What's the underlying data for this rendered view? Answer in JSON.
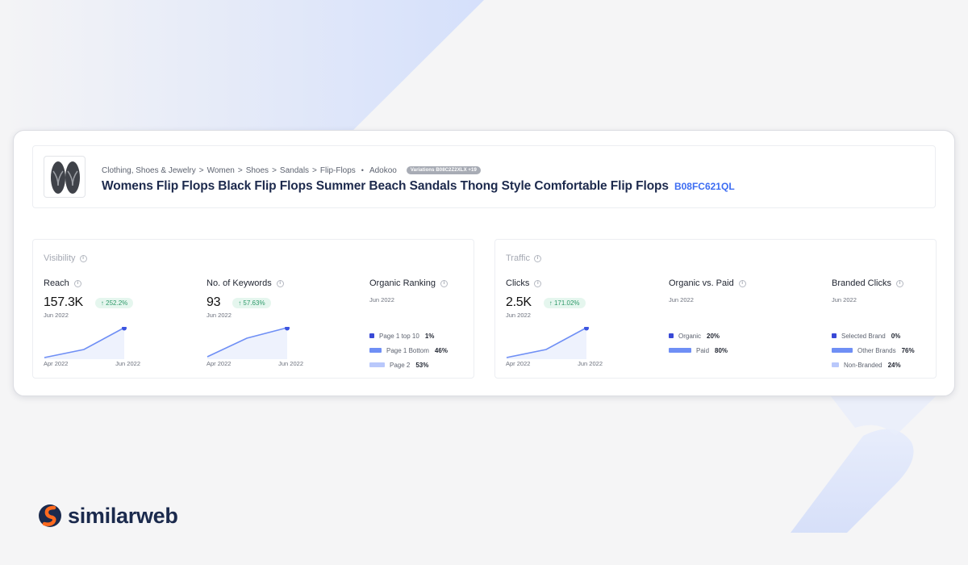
{
  "product": {
    "breadcrumb": [
      "Clothing, Shoes & Jewelry",
      "Women",
      "Shoes",
      "Sandals",
      "Flip-Flops"
    ],
    "brand": "Adokoo",
    "variations": "Variations B08C2Z2XLX +19",
    "title": "Womens Flip Flops Black Flip Flops Summer Beach Sandals Thong Style Comfortable Flip Flops",
    "asin": "B08FC621QL"
  },
  "visibility": {
    "title": "Visibility",
    "reach": {
      "label": "Reach",
      "value": "157.3K",
      "change": "↑ 252.2%",
      "period": "Jun 2022",
      "x_start": "Apr 2022",
      "x_end": "Jun 2022"
    },
    "keywords": {
      "label": "No. of Keywords",
      "value": "93",
      "change": "↑ 57.63%",
      "period": "Jun 2022",
      "x_start": "Apr 2022",
      "x_end": "Jun 2022"
    },
    "organic_ranking": {
      "label": "Organic Ranking",
      "period": "Jun 2022",
      "items": [
        {
          "label": "Page 1 top 10",
          "pct": "1%",
          "value": 1,
          "color": "#3949d6"
        },
        {
          "label": "Page 1 Bottom",
          "pct": "46%",
          "value": 46,
          "color": "#6f8ff5"
        },
        {
          "label": "Page 2",
          "pct": "53%",
          "value": 53,
          "color": "#b9c8fb"
        }
      ]
    }
  },
  "traffic": {
    "title": "Traffic",
    "clicks": {
      "label": "Clicks",
      "value": "2.5K",
      "change": "↑ 171.02%",
      "period": "Jun 2022",
      "x_start": "Apr 2022",
      "x_end": "Jun 2022"
    },
    "organic_vs_paid": {
      "label": "Organic vs. Paid",
      "period": "Jun 2022",
      "items": [
        {
          "label": "Organic",
          "pct": "20%",
          "value": 20,
          "color": "#3949d6"
        },
        {
          "label": "Paid",
          "pct": "80%",
          "value": 80,
          "color": "#6f8ff5"
        }
      ]
    },
    "branded_clicks": {
      "label": "Branded Clicks",
      "period": "Jun 2022",
      "items": [
        {
          "label": "Selected Brand",
          "pct": "0%",
          "value": 0,
          "color": "#3949d6"
        },
        {
          "label": "Other Brands",
          "pct": "76%",
          "value": 76,
          "color": "#6f8ff5"
        },
        {
          "label": "Non-Branded",
          "pct": "24%",
          "value": 24,
          "color": "#b9c8fb"
        }
      ]
    }
  },
  "brand_logo": {
    "text": "similarweb",
    "color": "#1b2a4d",
    "accent": "#ff6a1f"
  }
}
